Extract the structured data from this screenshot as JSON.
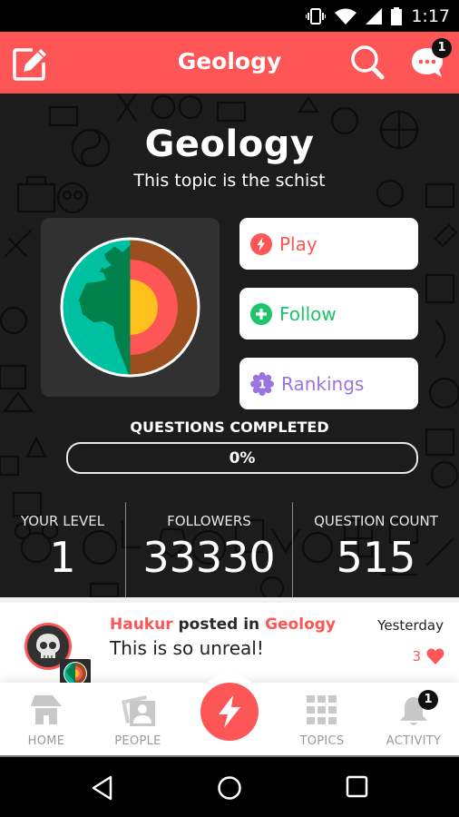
{
  "status_bar": {
    "time": "1:17",
    "icons": [
      "vibrate-icon",
      "wifi-icon",
      "signal-icon",
      "battery-icon"
    ]
  },
  "app_bar": {
    "title": "Geology",
    "compose_icon": "compose-icon",
    "search_icon": "search-icon",
    "chat_icon": "chat-icon",
    "chat_badge": "1"
  },
  "topic": {
    "title": "Geology",
    "subtitle": "This topic is the schist",
    "image": "earth-layers-icon",
    "actions": [
      {
        "label": "Play",
        "icon": "lightning-icon",
        "color": "#fe5656"
      },
      {
        "label": "Follow",
        "icon": "plus-circle-icon",
        "color": "#1fc46a"
      },
      {
        "label": "Rankings",
        "icon": "rank-badge-icon",
        "badge": "1",
        "color": "#9b74dd"
      }
    ],
    "progress": {
      "label": "QUESTIONS COMPLETED",
      "value_text": "0%",
      "value": 0
    },
    "stats": [
      {
        "label": "YOUR LEVEL",
        "value": "1"
      },
      {
        "label": "FOLLOWERS",
        "value": "33330"
      },
      {
        "label": "QUESTION COUNT",
        "value": "515"
      }
    ]
  },
  "feed": {
    "post": {
      "author": "Haukur",
      "verb": " posted in ",
      "topic": "Geology",
      "body": "This is so unreal!",
      "time": "Yesterday",
      "likes": "3"
    }
  },
  "bottom_nav": {
    "items": [
      {
        "label": "HOME",
        "icon": "home-icon"
      },
      {
        "label": "PEOPLE",
        "icon": "people-icon"
      },
      {
        "label": "",
        "icon": "lightning-icon"
      },
      {
        "label": "TOPICS",
        "icon": "grid-icon"
      },
      {
        "label": "ACTIVITY",
        "icon": "bell-icon",
        "badge": "1"
      }
    ]
  },
  "colors": {
    "accent": "#fe5656",
    "follow": "#1fc46a",
    "rankings": "#9b74dd",
    "background": "#1c1c1c"
  }
}
